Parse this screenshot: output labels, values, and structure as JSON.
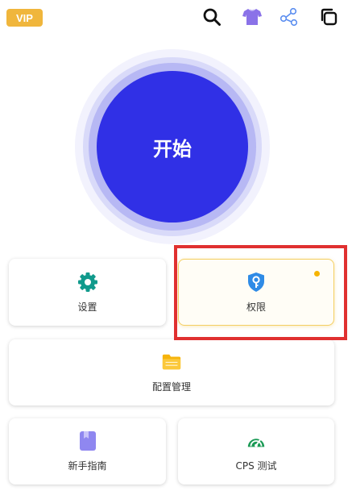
{
  "header": {
    "vip_label": "VIP",
    "icons": [
      "search-icon",
      "tshirt-icon",
      "share-icon",
      "copy-icon"
    ]
  },
  "start": {
    "label": "开始"
  },
  "cards": {
    "settings": {
      "label": "设置",
      "icon": "gear-icon"
    },
    "permission": {
      "label": "权限",
      "icon": "shield-key-icon"
    },
    "config": {
      "label": "配置管理",
      "icon": "folder-icon"
    },
    "guide": {
      "label": "新手指南",
      "icon": "bookmark-book-icon"
    },
    "cps": {
      "label": "CPS 测试",
      "icon": "speedometer-icon"
    }
  },
  "colors": {
    "accent": "#3030e6",
    "vip": "#f0b63c",
    "highlight": "#e03030",
    "settings_icon": "#119a8c",
    "permission_icon": "#2f8be6",
    "folder_icon": "#f6b40c",
    "guide_icon": "#8f87f0",
    "cps_icon": "#1a9a55",
    "tshirt_icon": "#8a72e8",
    "share_icon": "#5b8ef0"
  }
}
